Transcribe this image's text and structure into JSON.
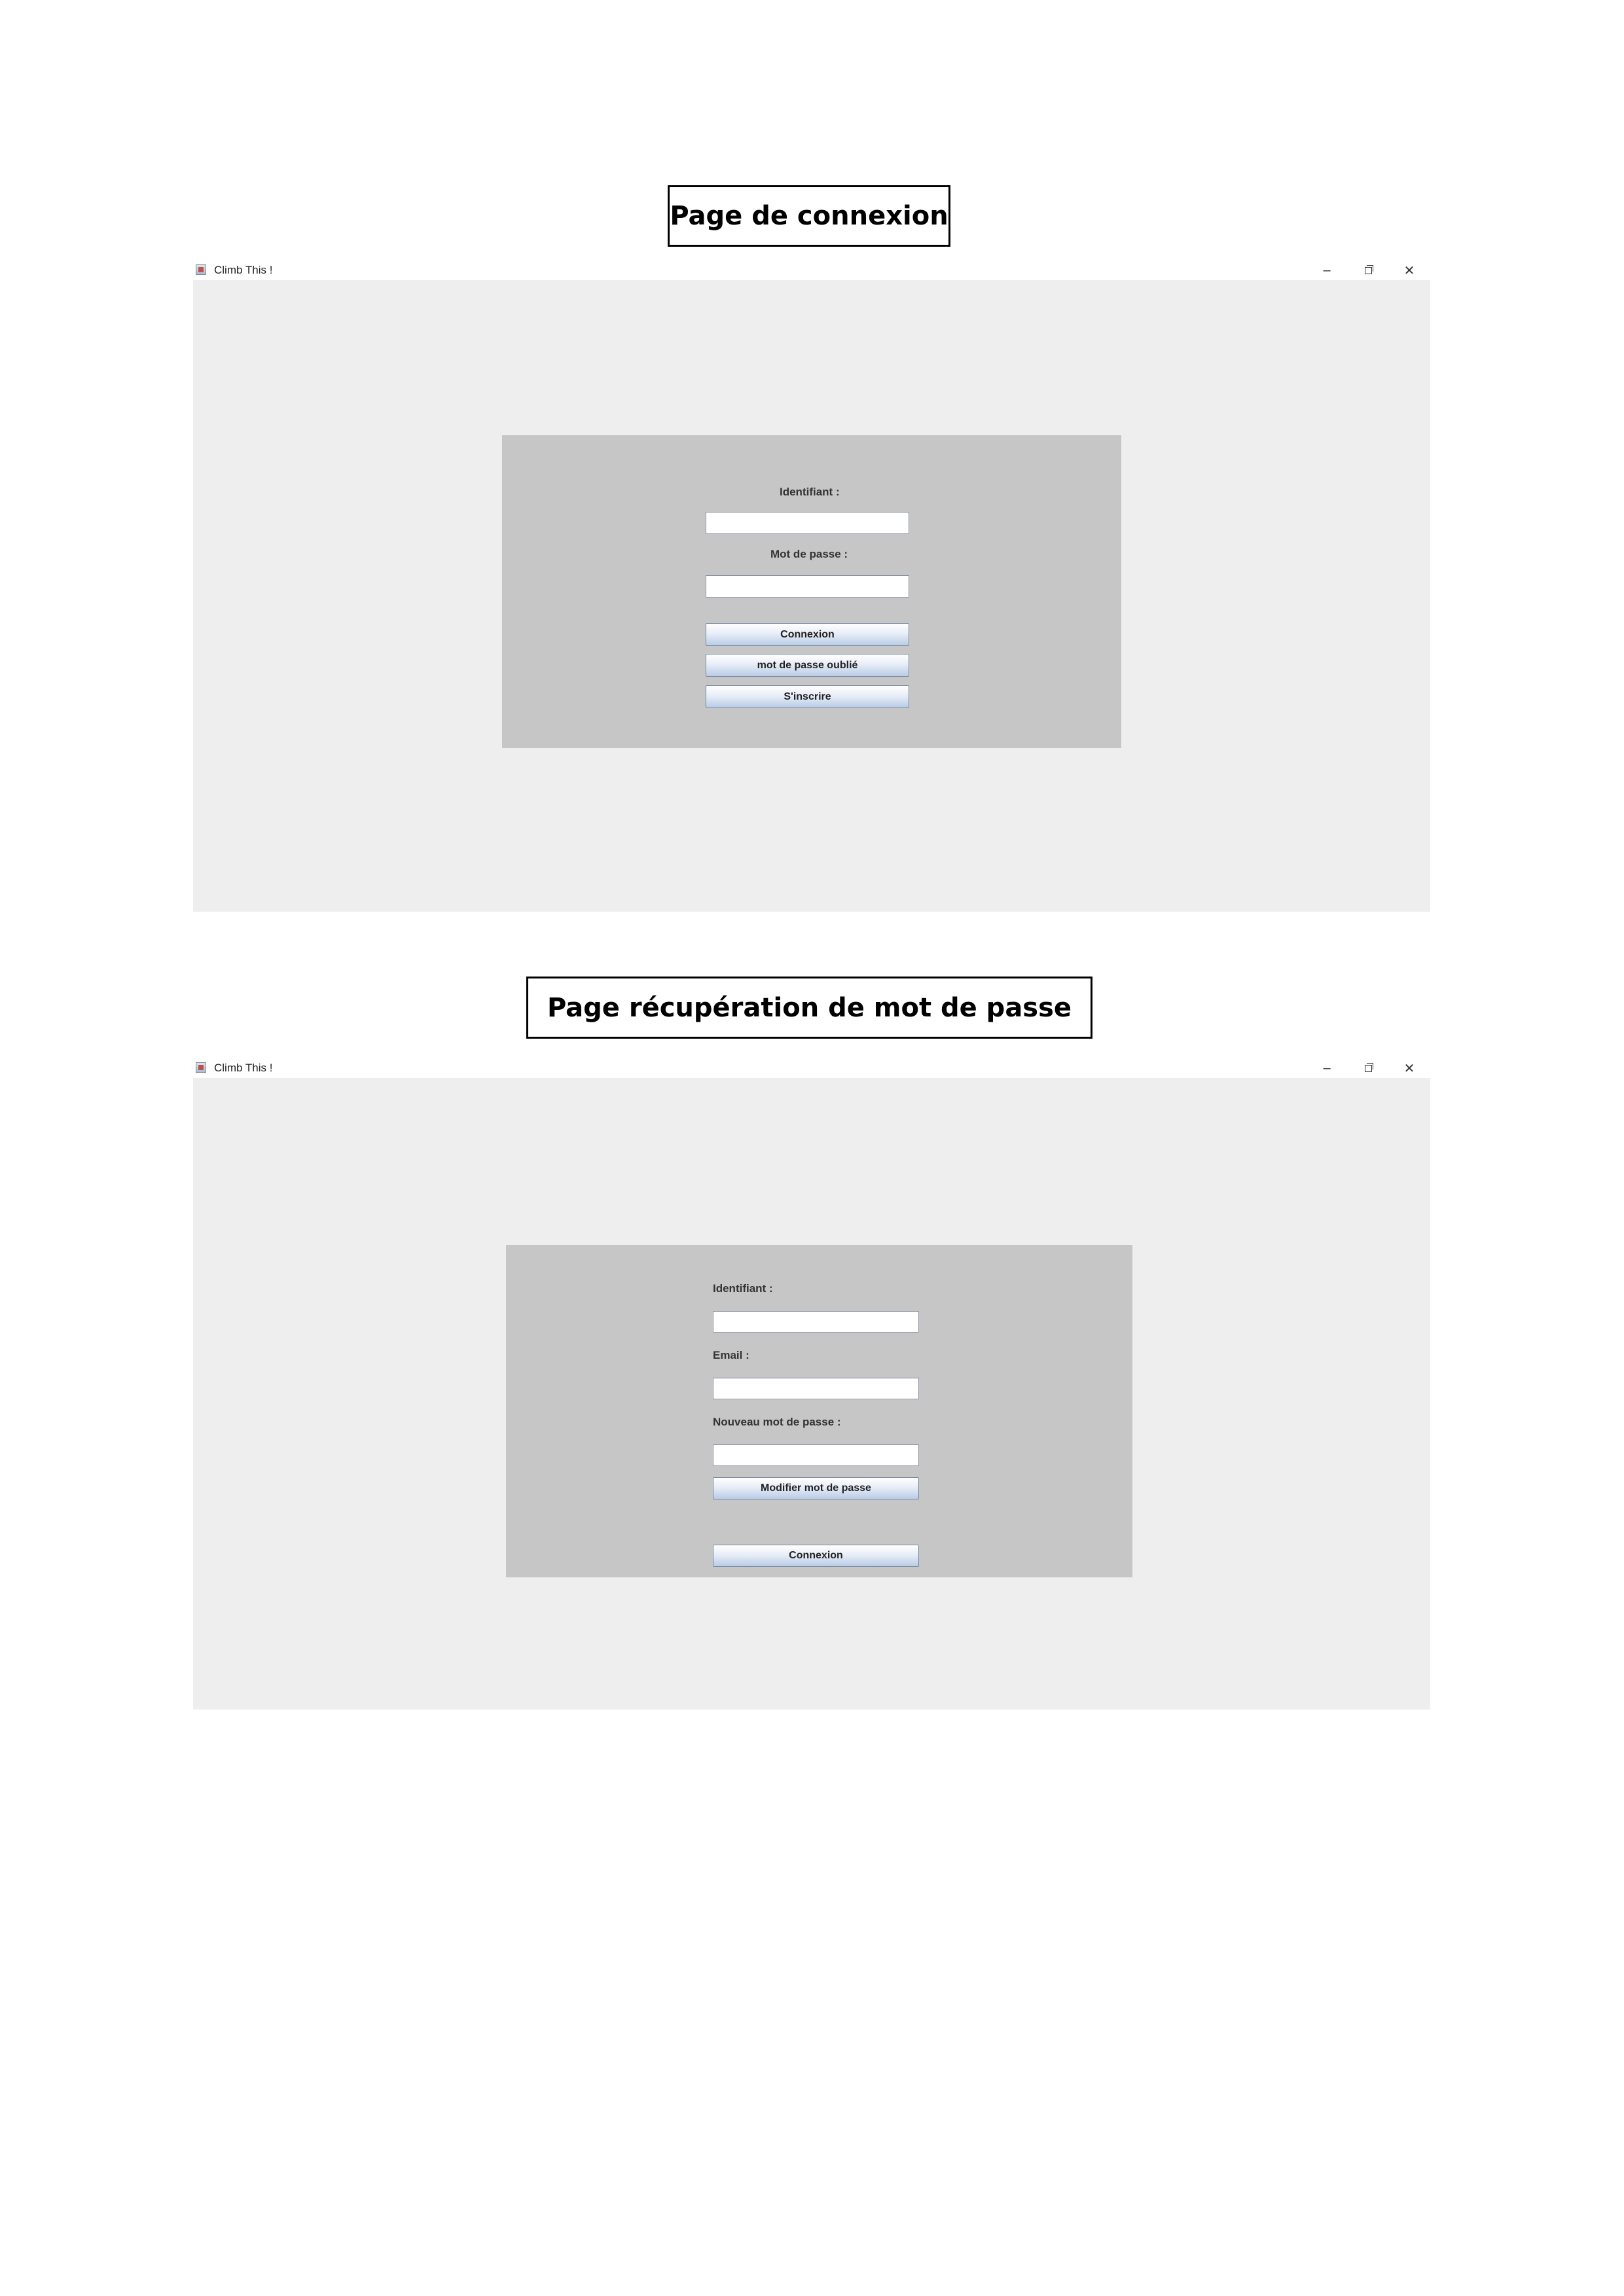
{
  "screen1": {
    "heading": "Page de connexion",
    "window_title": "Climb This !",
    "controls": {
      "minimize": "–",
      "close": "✕"
    },
    "form": {
      "id_label": "Identifiant :",
      "id_value": "",
      "pwd_label": "Mot de passe :",
      "pwd_value": "",
      "login_button": "Connexion",
      "forgot_button": "mot de passe oublié",
      "signup_button": "S'inscrire"
    }
  },
  "screen2": {
    "heading": "Page récupération de mot de passe",
    "window_title": "Climb This !",
    "controls": {
      "minimize": "–",
      "close": "✕"
    },
    "form": {
      "id_label": "Identifiant :",
      "id_value": "",
      "email_label": "Email :",
      "email_value": "",
      "newpwd_label": "Nouveau mot de passe :",
      "newpwd_value": "",
      "modify_button": "Modifier mot de passe",
      "login_button": "Connexion"
    }
  },
  "colors": {
    "window_bg": "#eeeeee",
    "panel_bg": "#c6c6c6",
    "button_gradient_top": "#ffffff",
    "button_gradient_bottom": "#b9cce6"
  }
}
